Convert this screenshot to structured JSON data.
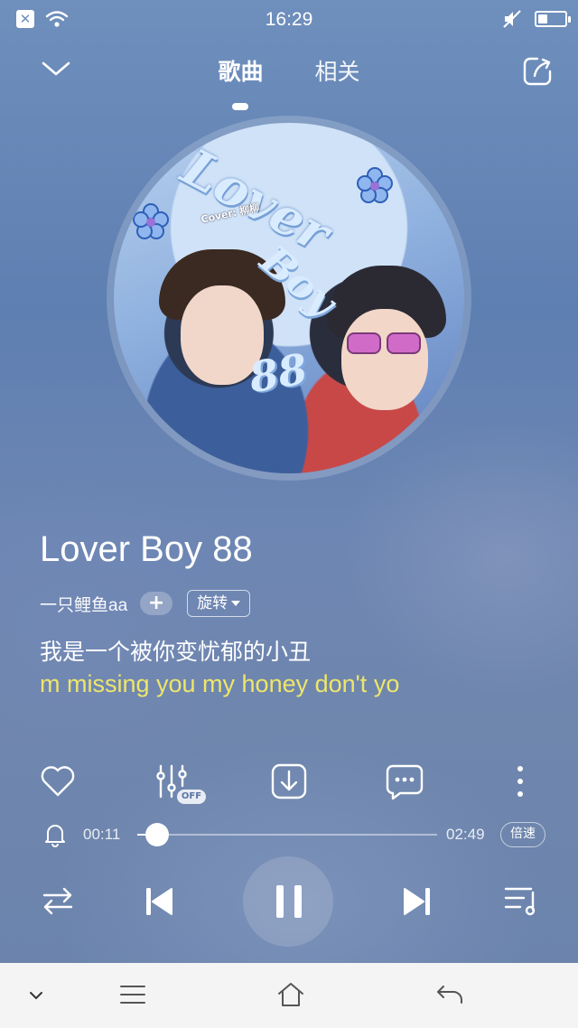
{
  "status_bar": {
    "time": "16:29",
    "battery_level": 0.45
  },
  "header": {
    "tabs": [
      {
        "label": "歌曲",
        "active": true
      },
      {
        "label": "相关",
        "active": false
      }
    ]
  },
  "cover": {
    "title_line1": "Lover",
    "title_line2": "Boy",
    "title_line3": "88",
    "credit": "Cover: 柳柳"
  },
  "song": {
    "title": "Lover Boy 88",
    "artist": "一只鲤鱼aa",
    "follow_label": "+",
    "tag_label": "旋转"
  },
  "lyrics": {
    "line_current": "我是一个被你变忧郁的小丑",
    "line_translation": "m missing you my honey don't yo"
  },
  "actions": {
    "effect_badge": "OFF"
  },
  "player": {
    "current_time": "00:11",
    "total_time": "02:49",
    "progress": 0.065,
    "speed_label": "倍速"
  },
  "colors": {
    "lyric_highlight": "#eee66a",
    "background": "#6f8fbd",
    "system_nav_bg": "#f4f4f4"
  },
  "icons": {
    "status_left": [
      "close-box-icon",
      "wifi-icon"
    ],
    "status_right": [
      "mute-icon",
      "battery-icon"
    ],
    "header_left": "chevron-down-icon",
    "header_right": "share-icon",
    "actions": [
      "heart-icon",
      "equalizer-icon",
      "download-icon",
      "comment-icon",
      "more-icon"
    ],
    "controls": [
      "repeat-icon",
      "previous-icon",
      "pause-icon",
      "next-icon",
      "playlist-icon"
    ],
    "system_nav": [
      "chevron-down-icon",
      "menu-icon",
      "home-icon",
      "back-icon"
    ]
  }
}
